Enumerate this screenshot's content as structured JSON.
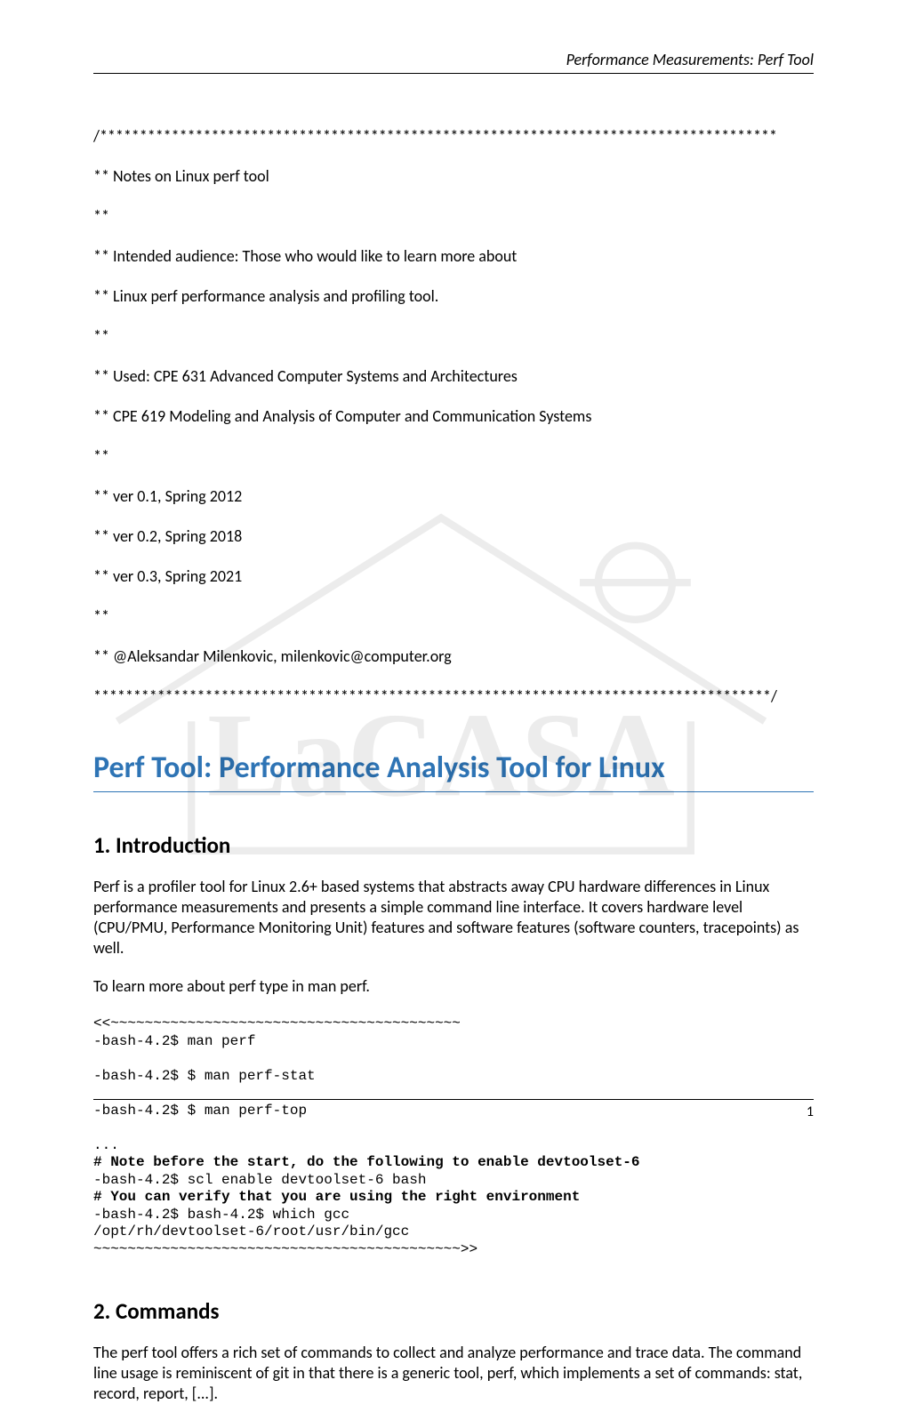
{
  "header": {
    "running_head": "Performance Measurements: Perf Tool"
  },
  "notes": {
    "line1": "/*************************************************************************************",
    "line2": "** Notes on Linux perf tool",
    "line3": "**",
    "line4": "** Intended audience: Those who would like to learn more about",
    "line5": "** Linux perf performance analysis and profiling tool.",
    "line6": "**",
    "line7": "** Used: CPE 631 Advanced Computer Systems and Architectures",
    "line8": "**           CPE 619 Modeling and Analysis of Computer and Communication Systems",
    "line9": "**",
    "line10": "** ver 0.1, Spring 2012",
    "line11": "** ver 0.2, Spring 2018",
    "line12": "** ver 0.3, Spring 2021",
    "line13": "**",
    "line14": "** @Aleksandar Milenkovic, milenkovic@computer.org",
    "line15": "*************************************************************************************/"
  },
  "title": "Perf Tool: Performance Analysis Tool for Linux",
  "sections": {
    "intro": {
      "heading": "1. Introduction",
      "p1": "Perf is a profiler tool for Linux 2.6+ based systems that abstracts away CPU hardware differences in Linux performance measurements and presents a simple command line interface. It covers hardware level (CPU/PMU, Performance Monitoring Unit) features and software features (software counters, tracepoints) as well.",
      "p2": "To learn more about perf type in man perf.",
      "code": {
        "l1": "<<~~~~~~~~~~~~~~~~~~~~~~~~~~~~~~~~~~~~~~~~~",
        "l2": "-bash-4.2$ man perf",
        "l3": "",
        "l4": "-bash-4.2$ $ man perf-stat",
        "l5": "",
        "l6": "-bash-4.2$ $ man perf-top",
        "l7": "",
        "l8": "...",
        "l9": "# Note before the start, do the following to enable devtoolset-6",
        "l10": "-bash-4.2$ scl enable devtoolset-6 bash",
        "l11": "# You can verify that you are using the right environment",
        "l12": "-bash-4.2$ bash-4.2$ which gcc",
        "l13": "/opt/rh/devtoolset-6/root/usr/bin/gcc",
        "l14": "~~~~~~~~~~~~~~~~~~~~~~~~~~~~~~~~~~~~~~~~~~~>>"
      }
    },
    "commands": {
      "heading": "2. Commands",
      "p1": "The perf tool offers a rich set of commands to collect and analyze performance and trace data. The command line usage is reminiscent of git in that there is a generic tool, perf, which implements a set of commands: stat, record, report, [...]."
    }
  },
  "footer": {
    "page_number": "1"
  }
}
